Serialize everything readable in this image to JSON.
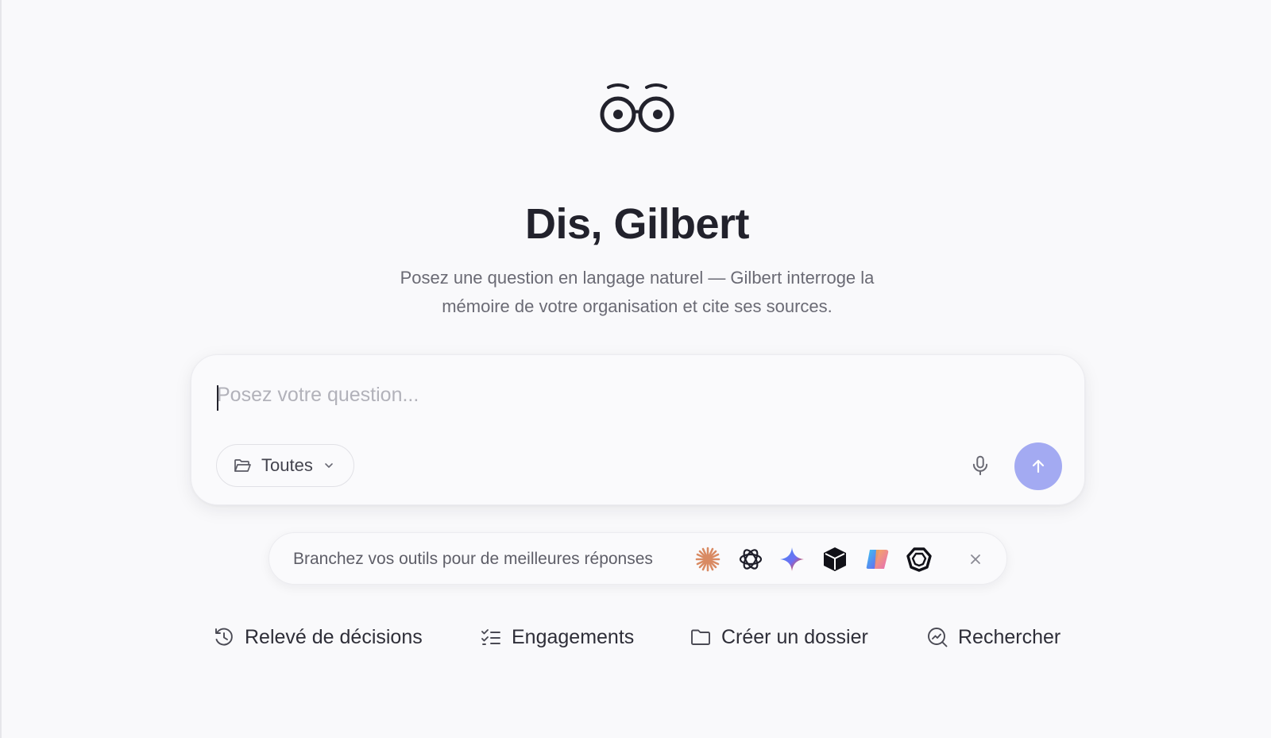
{
  "hero": {
    "logo_icon": "gilbert-eyes-logo-icon",
    "title": "Dis, Gilbert",
    "subtitle_line1": "Posez une question en langage naturel — Gilbert interroge la",
    "subtitle_line2": "mémoire de votre organisation et cite ses sources."
  },
  "composer": {
    "placeholder": "Posez votre question...",
    "value": "",
    "filter": {
      "label": "Toutes",
      "icon": "folder-open-icon"
    },
    "mic_icon": "microphone-icon",
    "send_icon": "arrow-up-icon",
    "send_color": "#a3aaf2"
  },
  "tools": {
    "text": "Branchez vos outils pour de meilleures réponses",
    "icons": [
      "claude-icon",
      "openai-icon",
      "gemini-icon",
      "cube-icon",
      "copilot-icon",
      "hexagon-ring-icon"
    ],
    "close_icon": "close-icon"
  },
  "quick_actions": [
    {
      "label": "Relevé de décisions",
      "icon": "history-icon"
    },
    {
      "label": "Engagements",
      "icon": "checklist-icon"
    },
    {
      "label": "Créer un dossier",
      "icon": "folder-icon"
    },
    {
      "label": "Rechercher",
      "icon": "search-trend-icon"
    }
  ]
}
